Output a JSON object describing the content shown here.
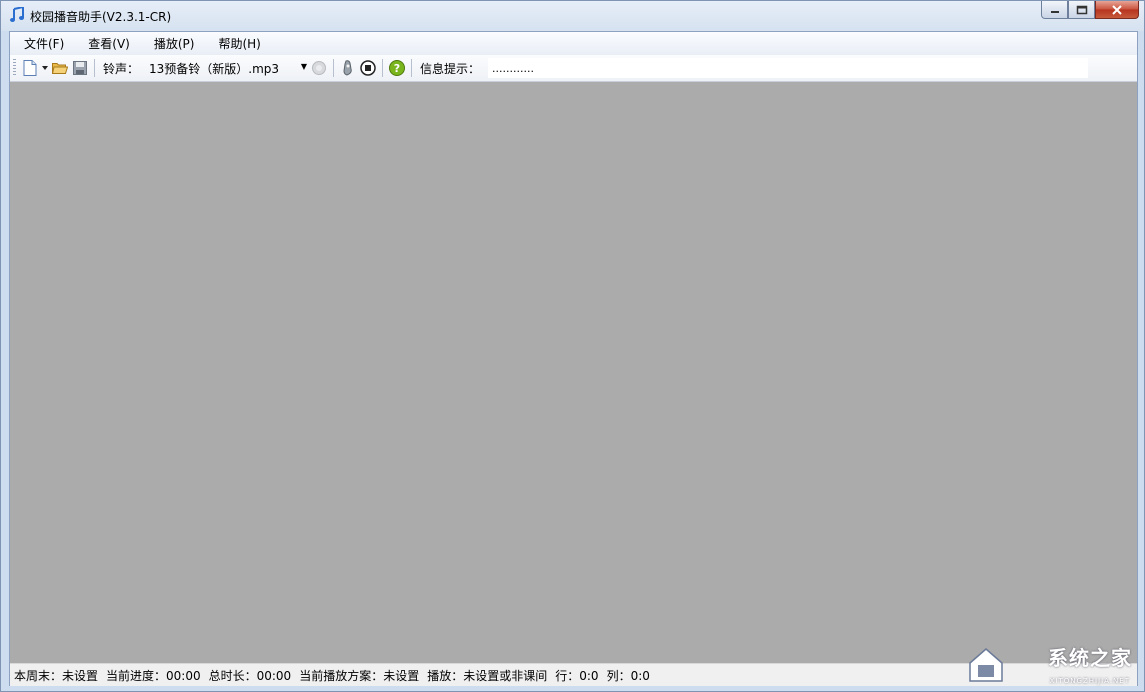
{
  "window": {
    "title": "校园播音助手(V2.3.1-CR)"
  },
  "menubar": {
    "items": [
      "文件(F)",
      "查看(V)",
      "播放(P)",
      "帮助(H)"
    ]
  },
  "toolbar": {
    "ringtone_label": "铃声：",
    "ringtone_value": "13预备铃（新版）.mp3",
    "info_label": "信息提示：",
    "info_value": "............"
  },
  "statusbar": {
    "weekend": "本周末：未设置",
    "progress": "当前进度：00:00",
    "total": "总时长：00:00",
    "scheme": "当前播放方案：未设置",
    "play": "播放：未设置或非课间",
    "row": "行：0:0",
    "col": "列：0:0"
  },
  "watermark": {
    "text": "系统之家",
    "subtext": "XITONGZHIJIA.NET"
  },
  "colors": {
    "work_area": "#ababab",
    "close_button": "#c9513c"
  }
}
